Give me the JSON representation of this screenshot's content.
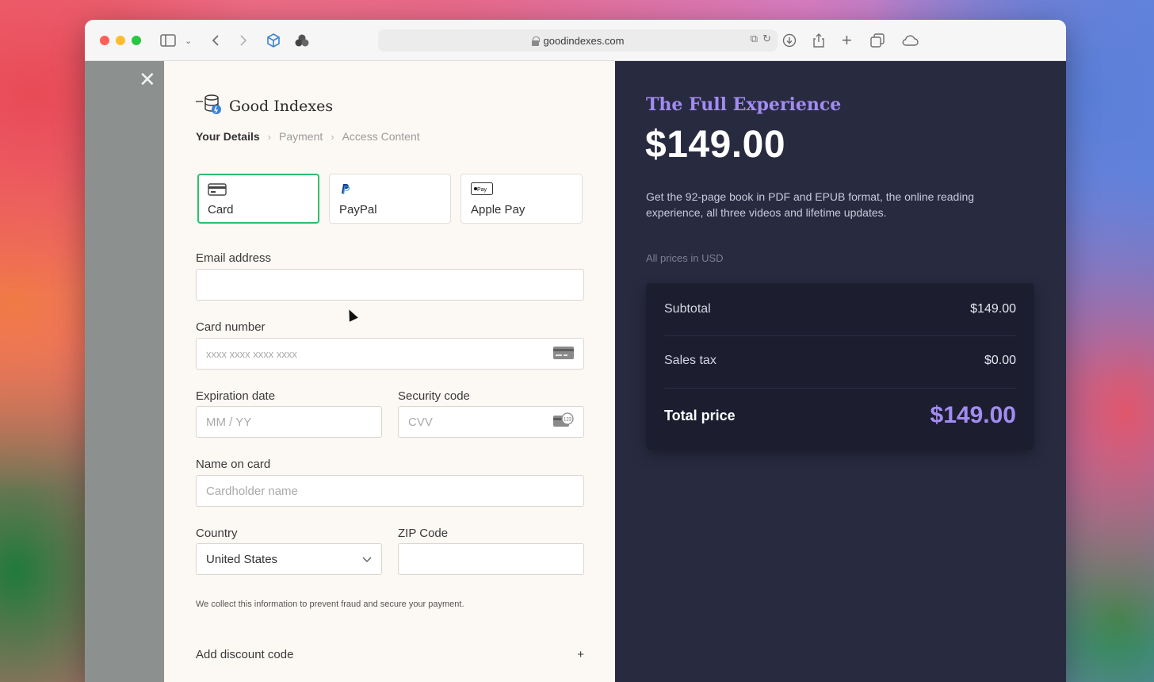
{
  "browser": {
    "url": "goodindexes.com"
  },
  "checkout": {
    "brand": "Good Indexes",
    "breadcrumbs": [
      "Your Details",
      "Payment",
      "Access Content"
    ],
    "payment_methods": [
      {
        "label": "Card",
        "selected": true
      },
      {
        "label": "PayPal",
        "selected": false
      },
      {
        "label": "Apple Pay",
        "selected": false
      }
    ],
    "fields": {
      "email_label": "Email address",
      "email_value": "",
      "card_label": "Card number",
      "card_placeholder": "xxxx xxxx xxxx xxxx",
      "exp_label": "Expiration date",
      "exp_placeholder": "MM / YY",
      "cvv_label": "Security code",
      "cvv_placeholder": "CVV",
      "name_label": "Name on card",
      "name_placeholder": "Cardholder name",
      "country_label": "Country",
      "country_value": "United States",
      "zip_label": "ZIP Code",
      "zip_value": ""
    },
    "fraud_note": "We collect this information to prevent fraud and secure your payment.",
    "discount_label": "Add discount code"
  },
  "product": {
    "title": "The Full Experience",
    "price": "$149.00",
    "description": "Get the 92-page book in PDF and EPUB format, the online reading experience, all three videos and lifetime updates.",
    "currency_note": "All prices in USD",
    "summary": {
      "subtotal_label": "Subtotal",
      "subtotal_value": "$149.00",
      "tax_label": "Sales tax",
      "tax_value": "$0.00",
      "total_label": "Total price",
      "total_value": "$149.00"
    }
  },
  "colors": {
    "accent_green": "#2ebf6a",
    "accent_purple": "#a28cf0",
    "dark_panel": "#282a40"
  }
}
